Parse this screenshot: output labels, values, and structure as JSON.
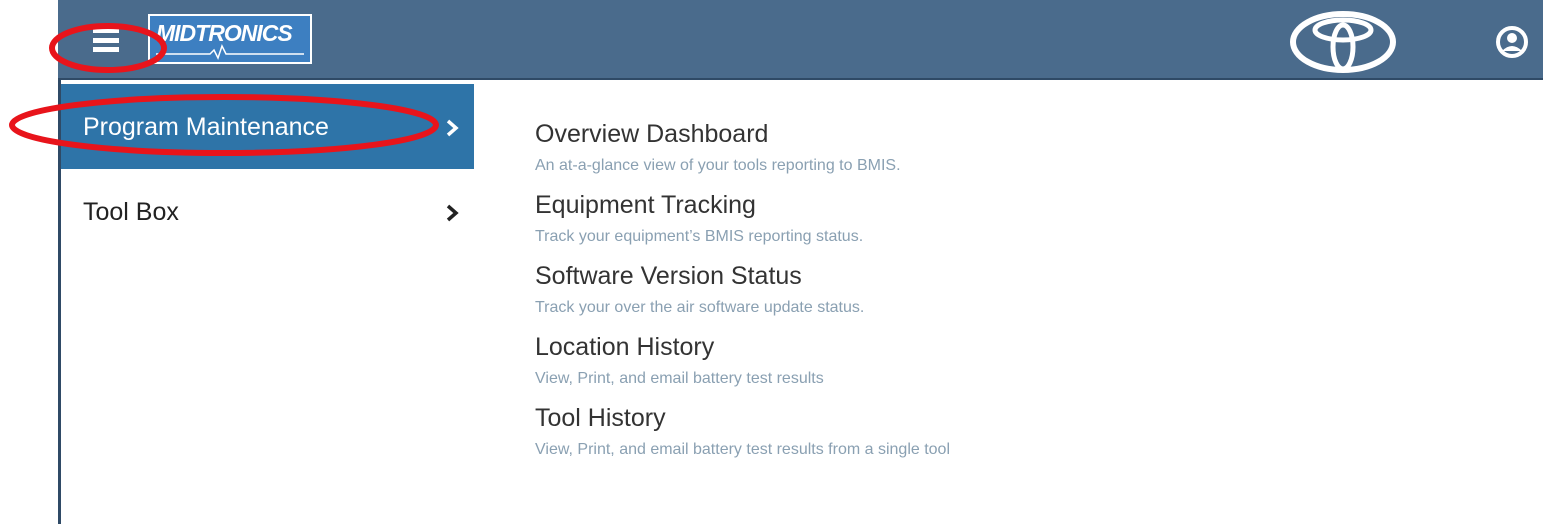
{
  "header": {
    "logo_text": "MIDTRONICS",
    "brand_icon": "toyota-logo-icon",
    "user_icon": "user-icon",
    "menu_icon": "hamburger-menu-icon"
  },
  "menu": {
    "items": [
      {
        "label": "Program Maintenance",
        "active": true
      },
      {
        "label": "Tool Box",
        "active": false
      }
    ]
  },
  "submenu": {
    "entries": [
      {
        "title": "Overview Dashboard",
        "description": "An at-a-glance view of your tools reporting to BMIS."
      },
      {
        "title": "Equipment Tracking",
        "description": "Track your equipment’s BMIS reporting status."
      },
      {
        "title": "Software Version Status",
        "description": "Track your over the air software update status."
      },
      {
        "title": "Location History",
        "description": "View, Print, and email battery test results"
      },
      {
        "title": "Tool History",
        "description": "View, Print, and email battery test results from a single tool"
      }
    ]
  },
  "colors": {
    "header_bg": "#4a6b8c",
    "active_item_bg": "#2e74a8",
    "annotation_red": "#e8141b"
  }
}
